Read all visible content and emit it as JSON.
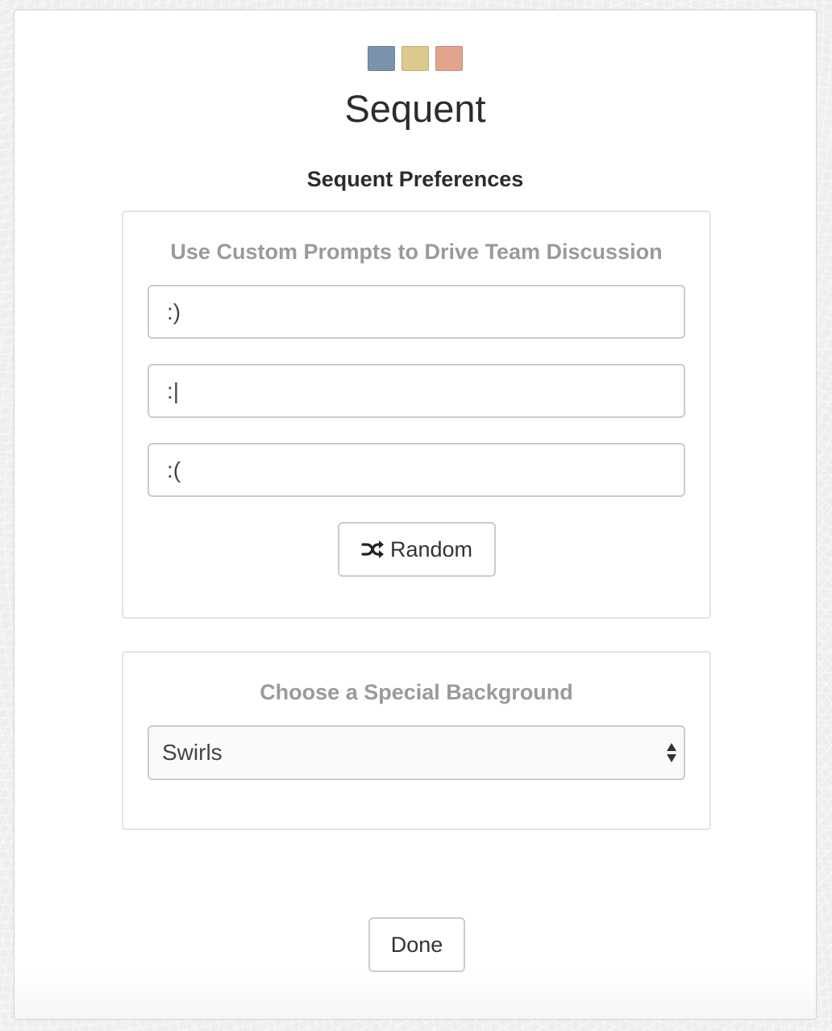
{
  "app": {
    "title": "Sequent",
    "logo_colors": [
      "#7a93ad",
      "#dcc98c",
      "#e3a48e"
    ]
  },
  "preferences": {
    "title": "Sequent Preferences"
  },
  "prompts_panel": {
    "heading": "Use Custom Prompts to Drive Team Discussion",
    "inputs": [
      {
        "value": ":)"
      },
      {
        "value": ":|"
      },
      {
        "value": ":("
      }
    ],
    "random_button": {
      "label": "Random",
      "icon": "shuffle-icon"
    }
  },
  "background_panel": {
    "heading": "Choose a Special Background",
    "select": {
      "selected": "Swirls",
      "icon": "select-arrows-icon"
    }
  },
  "footer": {
    "done_label": "Done"
  }
}
